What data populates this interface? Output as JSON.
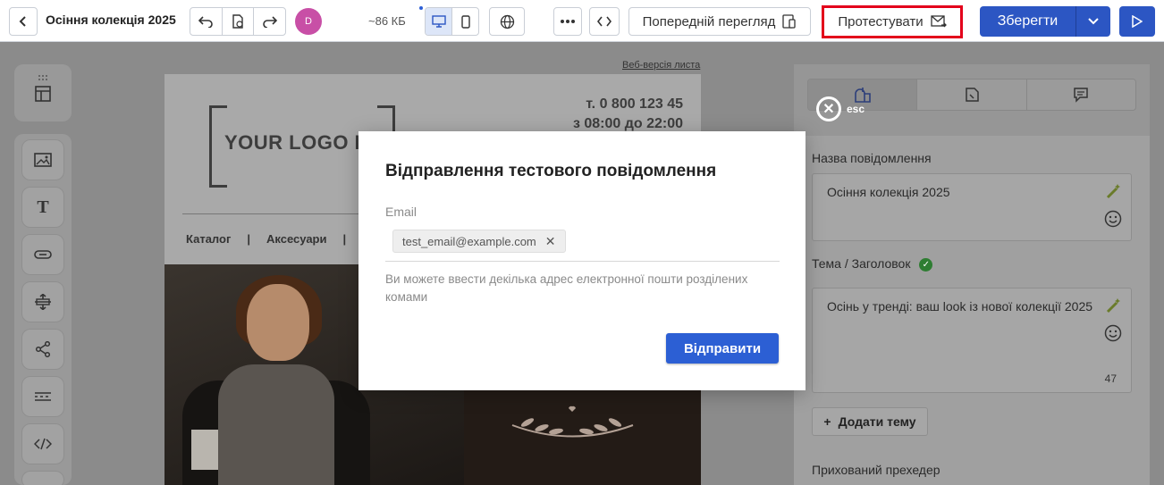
{
  "topbar": {
    "title": "Осіння колекція 2025",
    "avatar_initial": "D",
    "size_label": "~86 КБ",
    "preview_label": "Попередній перегляд",
    "test_label": "Протестувати",
    "save_label": "Зберегти"
  },
  "email": {
    "web_link": "Веб-версія листа",
    "logo_text": "YOUR LOGO HE",
    "phone": "т. 0 800 123 45",
    "hours": "з 08:00 до 22:00",
    "nav": [
      "Каталог",
      "|",
      "Аксесуари",
      "|"
    ]
  },
  "panel": {
    "name_label": "Назва повідомлення",
    "name_value": "Осіння колекція 2025",
    "subject_label": "Тема / Заголовок",
    "subject_value": "Осінь у тренді: ваш look із нової колекції 2025",
    "subject_count": "47",
    "add_topic": "Додати тему",
    "preheader_label": "Прихований прехедер"
  },
  "modal": {
    "esc_label": "esc",
    "title": "Відправлення тестового повідомлення",
    "email_label": "Email",
    "email_chip": "test_email@example.com",
    "hint": "Ви можете ввести декілька адрес електронної пошти розділених комами",
    "send_label": "Відправити"
  },
  "colors": {
    "primary": "#2c56c3",
    "highlight": "#e3001b",
    "avatar": "#c84fa6"
  }
}
